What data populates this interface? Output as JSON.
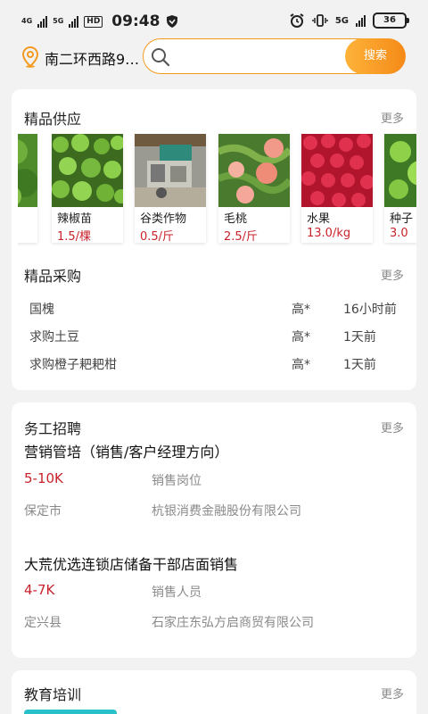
{
  "status_bar": {
    "net1": "4G",
    "net2": "5G",
    "hd": "HD",
    "time": "09:48",
    "net3": "5G",
    "battery": "36"
  },
  "header": {
    "location": "南二环西路9…",
    "search_placeholder": "",
    "search_button": "搜索"
  },
  "supply": {
    "title": "精品供应",
    "more": "更多",
    "products": [
      {
        "name": "辣椒苗",
        "price": "1.5/棵",
        "photo": "pepper-seedlings-photo"
      },
      {
        "name": "谷类作物",
        "price": "0.5/斤",
        "photo": "grain-machine-photo"
      },
      {
        "name": "毛桃",
        "price": "2.5/斤",
        "photo": "peach-photo"
      },
      {
        "name": "水果",
        "price": "13.0/kg",
        "photo": "raspberry-photo"
      },
      {
        "name": "种子",
        "price": "3.0",
        "photo": "green-fruit-photo"
      }
    ]
  },
  "purchase": {
    "title": "精品采购",
    "more": "更多",
    "rows": [
      {
        "name": "国槐",
        "level": "高*",
        "time": "16小时前"
      },
      {
        "name": "求购土豆",
        "level": "高*",
        "time": "1天前"
      },
      {
        "name": "求购橙子耙耙柑",
        "level": "高*",
        "time": "1天前"
      }
    ]
  },
  "jobs": {
    "title": "务工招聘",
    "more": "更多",
    "items": [
      {
        "title": "营销管培（销售/客户经理方向）",
        "salary": "5-10K",
        "position": "销售岗位",
        "location": "保定市",
        "company": "杭银消费金融股份有限公司"
      },
      {
        "title": "大荒优选连锁店储备干部店面销售",
        "salary": "4-7K",
        "position": "销售人员",
        "location": "定兴县",
        "company": "石家庄东弘方启商贸有限公司"
      }
    ]
  },
  "education": {
    "title": "教育培训",
    "more": "更多"
  },
  "colors": {
    "accent": "#f39a1e",
    "price_red": "#c8232c",
    "muted": "#8a8a8a",
    "edu_tab": "#29c1c9"
  }
}
